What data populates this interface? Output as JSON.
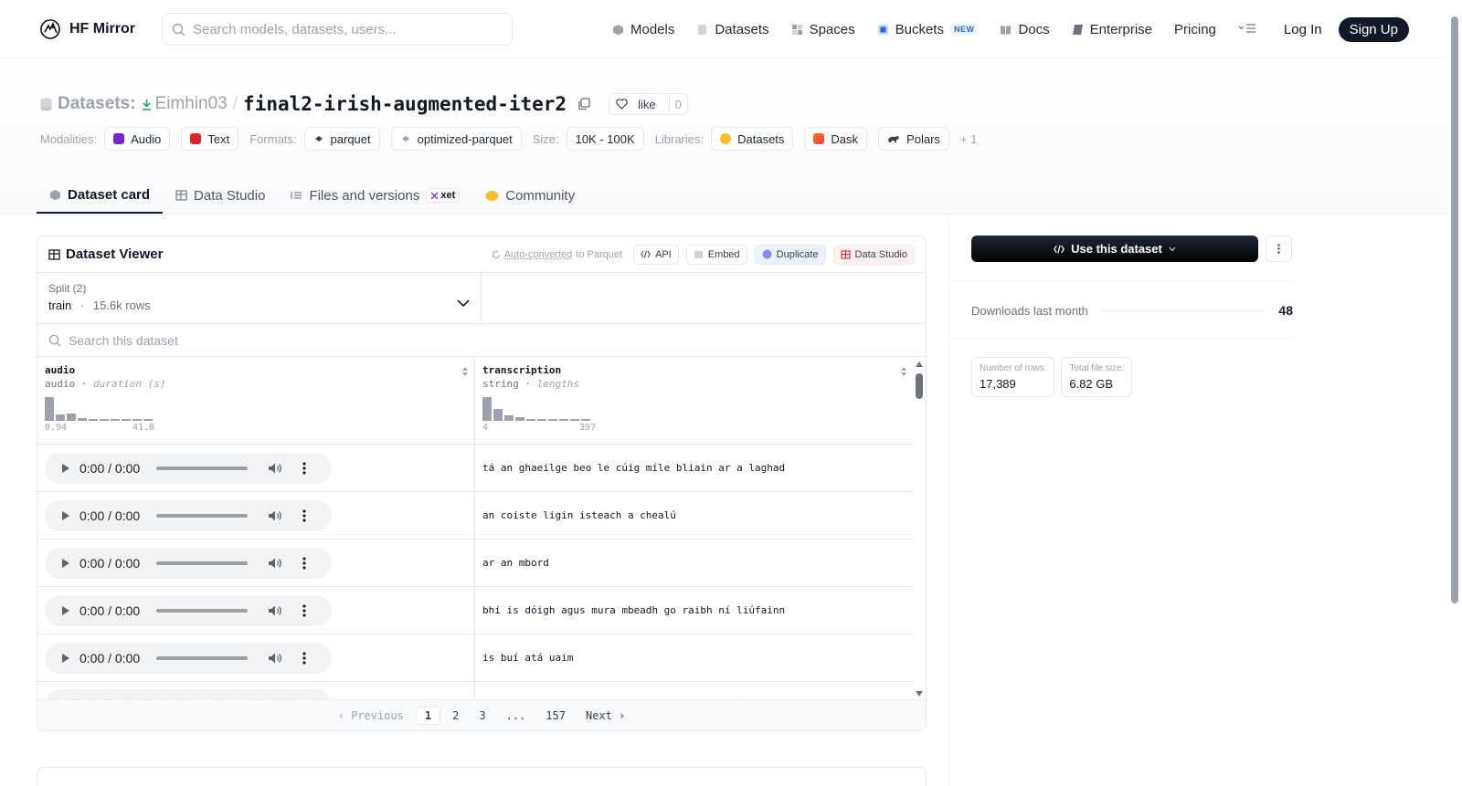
{
  "header": {
    "logo_text": "HF Mirror",
    "search_placeholder": "Search models, datasets, users...",
    "nav": {
      "models": "Models",
      "datasets": "Datasets",
      "spaces": "Spaces",
      "buckets": "Buckets",
      "buckets_badge": "NEW",
      "docs": "Docs",
      "enterprise": "Enterprise",
      "pricing": "Pricing"
    },
    "login": "Log In",
    "signup": "Sign Up"
  },
  "repo": {
    "section": "Datasets:",
    "owner": "Eimhin03",
    "separator": "/",
    "name": "final2-irish-augmented-iter2",
    "like_label": "like",
    "like_count": "0"
  },
  "tags": {
    "modalities_label": "Modalities:",
    "modalities": [
      "Audio",
      "Text"
    ],
    "formats_label": "Formats:",
    "formats": [
      "parquet",
      "optimized-parquet"
    ],
    "size_label": "Size:",
    "size": "10K - 100K",
    "libraries_label": "Libraries:",
    "libraries": [
      "Datasets",
      "Dask",
      "Polars"
    ],
    "more": "+ 1"
  },
  "tabs": {
    "card": "Dataset card",
    "studio": "Data Studio",
    "files": "Files and versions",
    "xet": "xet",
    "community": "Community"
  },
  "viewer": {
    "title": "Dataset Viewer",
    "auto_converted": "Auto-converted",
    "to_parquet": "to Parquet",
    "api": "API",
    "embed": "Embed",
    "duplicate": "Duplicate",
    "data_studio": "Data Studio",
    "split_label": "Split (2)",
    "split_value": "train",
    "split_sep": "·",
    "split_rows": "15.6k rows",
    "search_placeholder": "Search this dataset",
    "columns": [
      {
        "name": "audio",
        "type": "audio",
        "sep": "·",
        "stat": "duration (s)",
        "min": "0.94",
        "max": "41.8",
        "hist": [
          1.0,
          0.28,
          0.32,
          0.12,
          0.06,
          0.04,
          0.04,
          0.03,
          0.03,
          0.03
        ]
      },
      {
        "name": "transcription",
        "type": "string",
        "sep": "·",
        "stat": "lengths",
        "min": "4",
        "max": "397",
        "hist": [
          1.0,
          0.5,
          0.22,
          0.14,
          0.08,
          0.05,
          0.04,
          0.03,
          0.03,
          0.03
        ]
      }
    ],
    "rows": [
      {
        "time": "0:00 / 0:00",
        "text": "tá an ghaeilge beo le cúig míle bliain ar a laghad"
      },
      {
        "time": "0:00 / 0:00",
        "text": "an coiste ligin isteach a chealú"
      },
      {
        "time": "0:00 / 0:00",
        "text": "ar an mbord"
      },
      {
        "time": "0:00 / 0:00",
        "text": "bhí is dóigh agus mura mbeadh go raibh ní liúfainn"
      },
      {
        "time": "0:00 / 0:00",
        "text": "is buí atá uaim"
      }
    ],
    "pager": {
      "previous": "Previous",
      "pages": [
        "1",
        "2",
        "3",
        "...",
        "157"
      ],
      "current": "1",
      "next": "Next"
    }
  },
  "sidebar": {
    "use_button": "Use this dataset",
    "downloads_label": "Downloads last month",
    "downloads_value": "48",
    "rows_label": "Number of rows:",
    "rows_value": "17,389",
    "size_label": "Total file size:",
    "size_value": "6.82 GB"
  },
  "colors": {
    "accent_dark": "#111827",
    "audio_tag": "#7e22ce",
    "text_tag": "#dc2626"
  }
}
